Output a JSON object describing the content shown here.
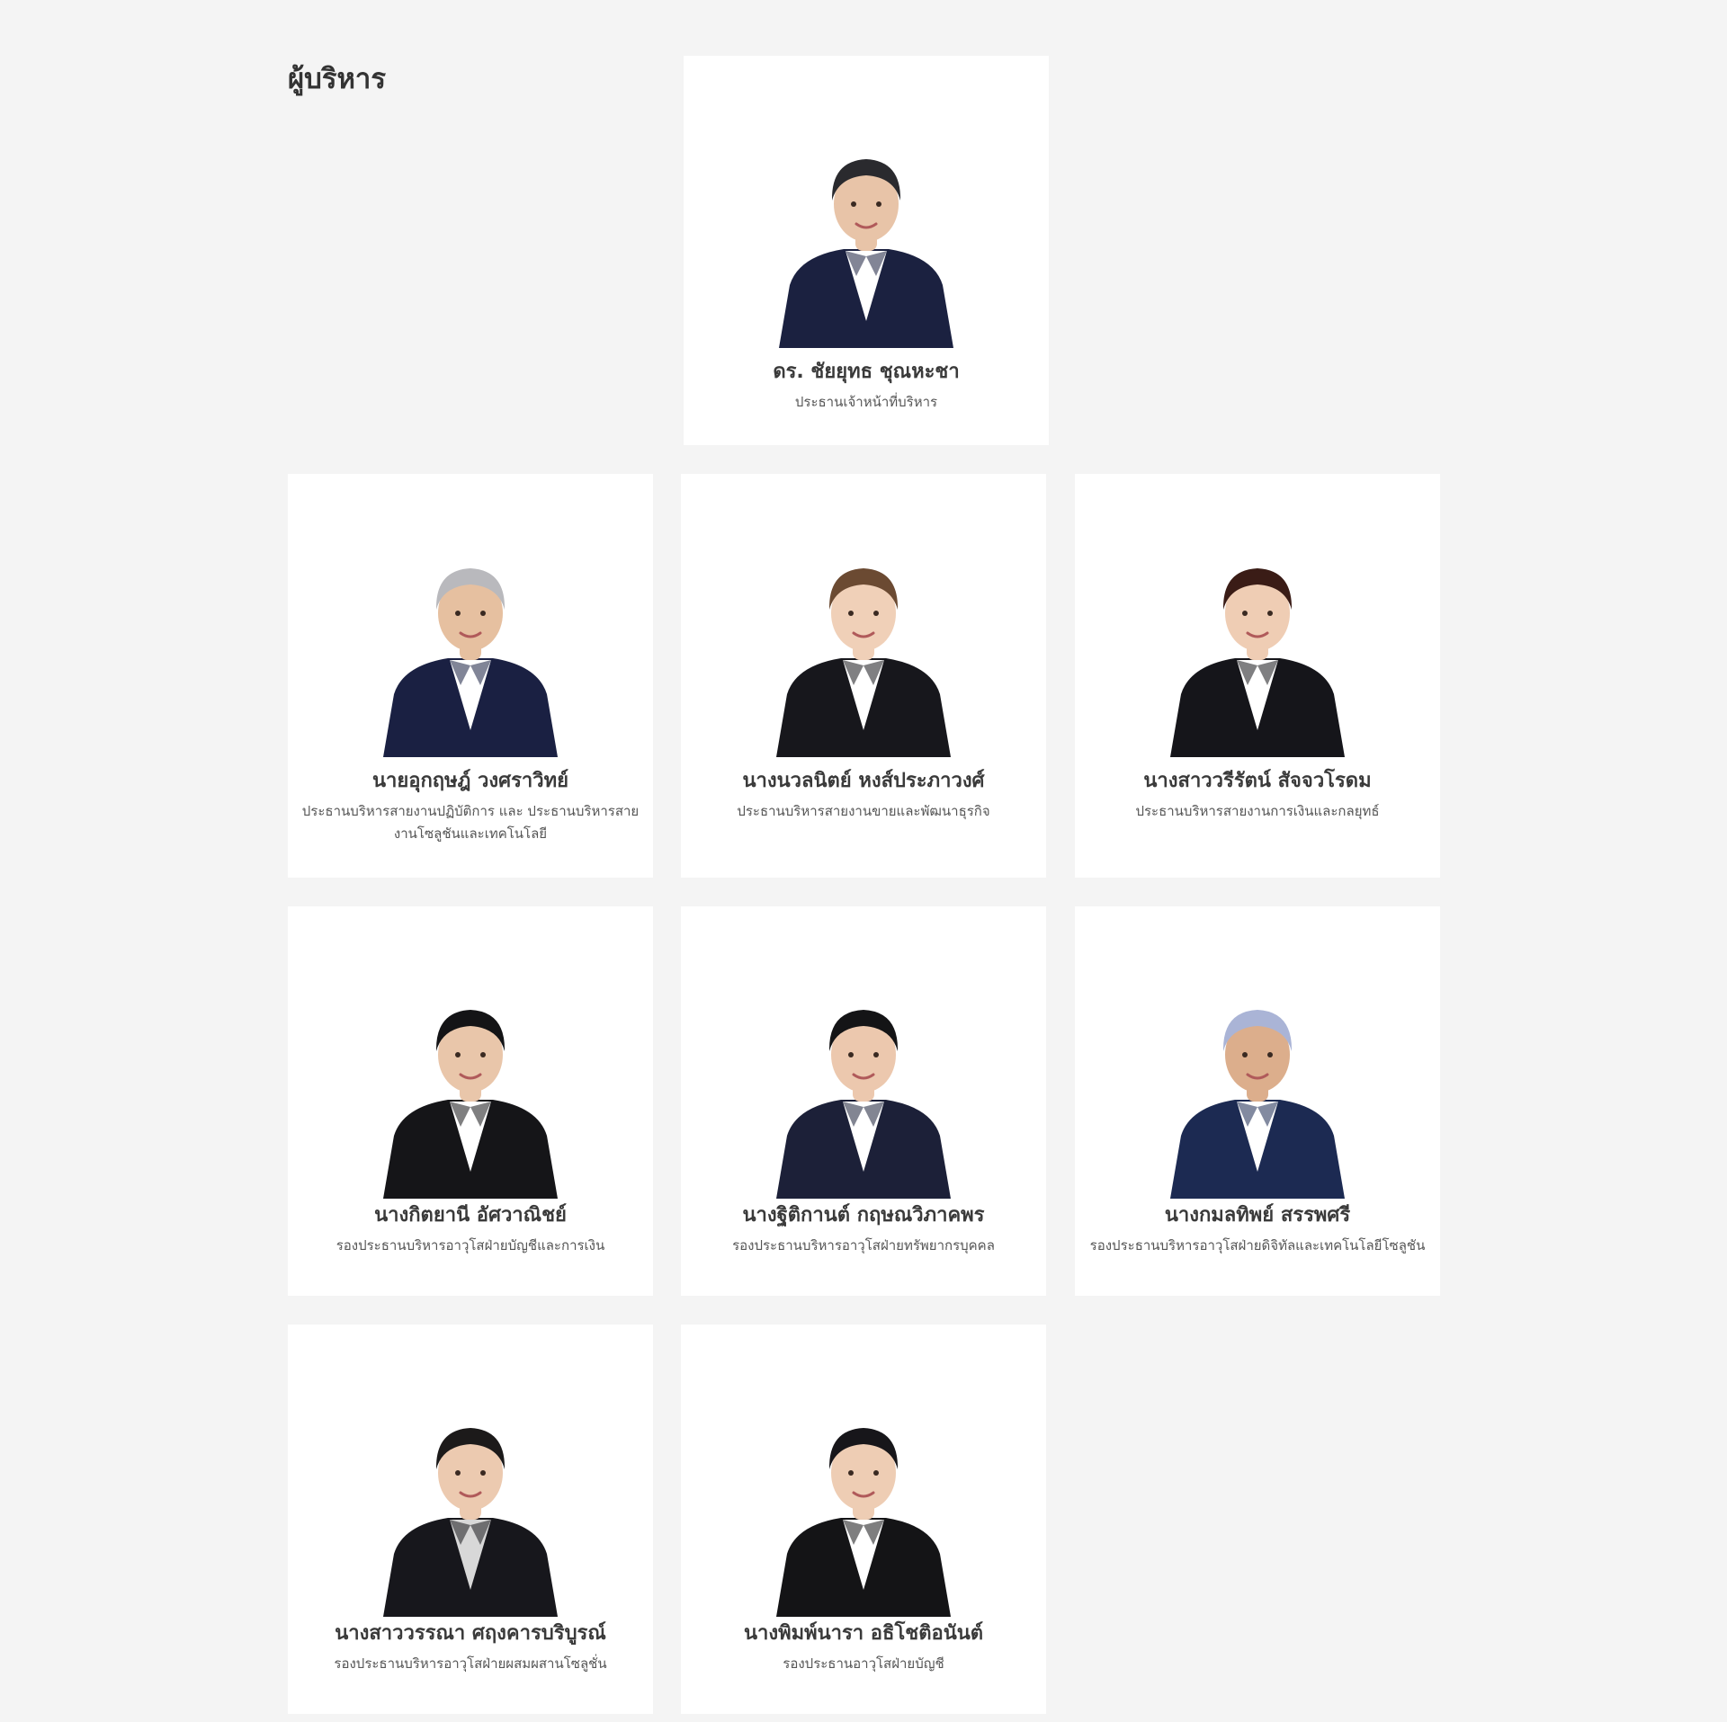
{
  "section": {
    "title": "ผู้บริหาร"
  },
  "executives": [
    {
      "name": "ดร. ชัยยุทธ ชุณหะชา",
      "role": "ประธานเจ้าหน้าที่บริหาร",
      "hair": "#2a2a2e",
      "suit": "#1b2140",
      "shirt": "#ffffff",
      "skin": "#e8c4a8"
    },
    {
      "name": "นายอุกฤษฎ์ วงศราวิทย์",
      "role": "ประธานบริหารสายงานปฏิบัติการ และ ประธานบริหารสายงานโซลูชันและเทคโนโลยี",
      "hair": "#b9b9bd",
      "suit": "#1a2042",
      "shirt": "#ffffff",
      "skin": "#e6c0a0"
    },
    {
      "name": "นางนวลนิตย์ หงส์ประภาวงศ์",
      "role": "ประธานบริหารสายงานขายและพัฒนาธุรกิจ",
      "hair": "#6b4a32",
      "suit": "#17171c",
      "shirt": "#ffffff",
      "skin": "#f0d0b8"
    },
    {
      "name": "นางสาววรีรัตน์ สัจจวโรดม",
      "role": "ประธานบริหารสายงานการเงินและกลยุทธ์",
      "hair": "#3a1c16",
      "suit": "#15151a",
      "shirt": "#ffffff",
      "skin": "#efcdb4"
    },
    {
      "name": "นางกิตยานี อัศวาณิชย์",
      "role": "รองประธานบริหารอาวุโสฝ่ายบัญชีและการเงิน",
      "hair": "#141416",
      "suit": "#151518",
      "shirt": "#ffffff",
      "skin": "#e9c6aa"
    },
    {
      "name": "นางฐิติกานต์ กฤษณวิภาคพร",
      "role": "รองประธานบริหารอาวุโสฝ่ายทรัพยากรบุคคล",
      "hair": "#141416",
      "suit": "#1c2038",
      "shirt": "#ffffff",
      "skin": "#ecc8ae"
    },
    {
      "name": "นางกมลทิพย์ สรรพศรี",
      "role": "รองประธานบริหารอาวุโสฝ่ายดิจิทัลและเทคโนโลยีโซลูชัน",
      "hair": "#aab4d6",
      "suit": "#1c2a52",
      "shirt": "#ffffff",
      "skin": "#dcae8c"
    },
    {
      "name": "นางสาววรรณา ศฤงคารบริบูรณ์",
      "role": "รองประธานบริหารอาวุโสฝ่ายผสมผสานโซลูชั่น",
      "hair": "#1c1a1a",
      "suit": "#17171c",
      "shirt": "#d8d8d8",
      "skin": "#eccab0"
    },
    {
      "name": "นางพิมพ์นารา อธิโชติอนันต์",
      "role": "รองประธานอาวุโสฝ่ายบัญชี",
      "hair": "#17161a",
      "suit": "#141416",
      "shirt": "#ffffff",
      "skin": "#eecdb4"
    }
  ]
}
